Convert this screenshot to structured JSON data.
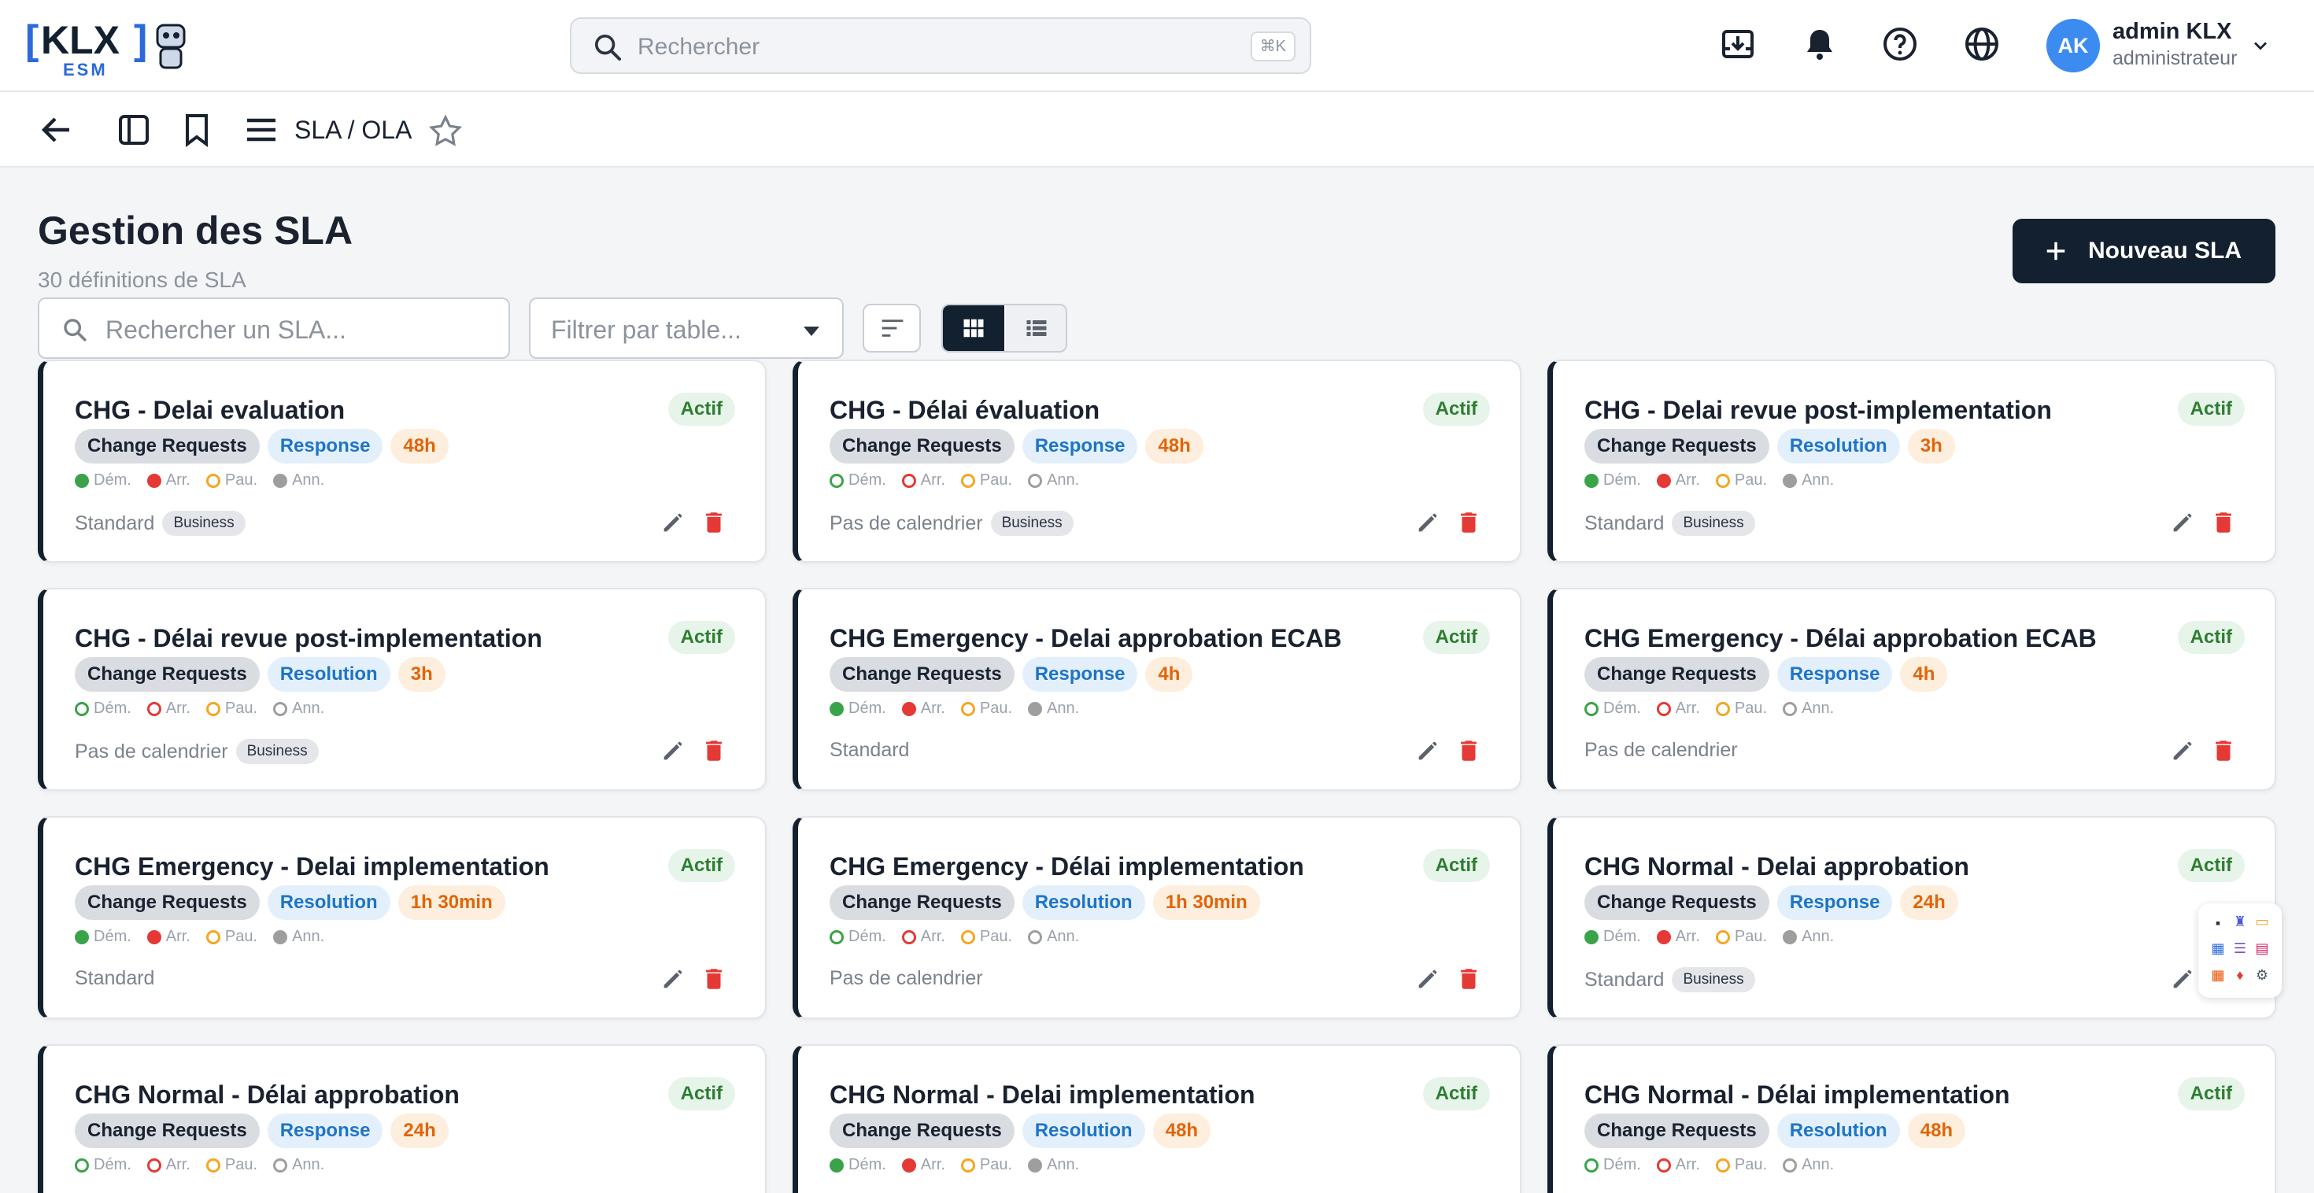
{
  "app": {
    "logo_text": "KLX",
    "logo_sub": "ESM",
    "search_placeholder": "Rechercher",
    "search_shortcut": "⌘K",
    "user": {
      "initials": "AK",
      "name": "admin KLX",
      "role": "administrateur"
    },
    "icons": [
      "download-icon",
      "bell-icon",
      "help-icon",
      "globe-icon",
      "chevron-down-icon"
    ]
  },
  "subbar": {
    "breadcrumb": "SLA / OLA"
  },
  "page": {
    "title": "Gestion des SLA",
    "subtitle": "30 définitions de SLA",
    "new_button": "Nouveau SLA",
    "search_placeholder": "Rechercher un SLA...",
    "filter_placeholder": "Filtrer par table..."
  },
  "legend_labels": {
    "dem": "Dém.",
    "arr": "Arr.",
    "pau": "Pau.",
    "ann": "Ann."
  },
  "colors": {
    "green": "#3aa34a",
    "red": "#e53935",
    "orange": "#f5a623",
    "gray": "#9e9e9e",
    "dark": "#13202f"
  },
  "cards": [
    {
      "title": "CHG - Delai evaluation",
      "status": "Actif",
      "table": "Change Requests",
      "type": "Response",
      "duration": "48h",
      "filled": true,
      "calendar": "Standard",
      "badge": "Business"
    },
    {
      "title": "CHG - Délai évaluation",
      "status": "Actif",
      "table": "Change Requests",
      "type": "Response",
      "duration": "48h",
      "filled": false,
      "calendar": "Pas de calendrier",
      "badge": "Business"
    },
    {
      "title": "CHG - Delai revue post-implementation",
      "status": "Actif",
      "table": "Change Requests",
      "type": "Resolution",
      "duration": "3h",
      "filled": true,
      "calendar": "Standard",
      "badge": "Business"
    },
    {
      "title": "CHG - Délai revue post-implementation",
      "status": "Actif",
      "table": "Change Requests",
      "type": "Resolution",
      "duration": "3h",
      "filled": false,
      "calendar": "Pas de calendrier",
      "badge": "Business"
    },
    {
      "title": "CHG Emergency - Delai approbation ECAB",
      "status": "Actif",
      "table": "Change Requests",
      "type": "Response",
      "duration": "4h",
      "filled": true,
      "calendar": "Standard",
      "badge": ""
    },
    {
      "title": "CHG Emergency - Délai approbation ECAB",
      "status": "Actif",
      "table": "Change Requests",
      "type": "Response",
      "duration": "4h",
      "filled": false,
      "calendar": "Pas de calendrier",
      "badge": ""
    },
    {
      "title": "CHG Emergency - Delai implementation",
      "status": "Actif",
      "table": "Change Requests",
      "type": "Resolution",
      "duration": "1h 30min",
      "filled": true,
      "calendar": "Standard",
      "badge": ""
    },
    {
      "title": "CHG Emergency - Délai implementation",
      "status": "Actif",
      "table": "Change Requests",
      "type": "Resolution",
      "duration": "1h 30min",
      "filled": false,
      "calendar": "Pas de calendrier",
      "badge": ""
    },
    {
      "title": "CHG Normal - Delai approbation",
      "status": "Actif",
      "table": "Change Requests",
      "type": "Response",
      "duration": "24h",
      "filled": true,
      "calendar": "Standard",
      "badge": "Business"
    },
    {
      "title": "CHG Normal - Délai approbation",
      "status": "Actif",
      "table": "Change Requests",
      "type": "Response",
      "duration": "24h",
      "filled": false,
      "calendar": "",
      "badge": ""
    },
    {
      "title": "CHG Normal - Delai implementation",
      "status": "Actif",
      "table": "Change Requests",
      "type": "Resolution",
      "duration": "48h",
      "filled": true,
      "calendar": "",
      "badge": ""
    },
    {
      "title": "CHG Normal - Délai implementation",
      "status": "Actif",
      "table": "Change Requests",
      "type": "Resolution",
      "duration": "48h",
      "filled": false,
      "calendar": "",
      "badge": ""
    }
  ]
}
